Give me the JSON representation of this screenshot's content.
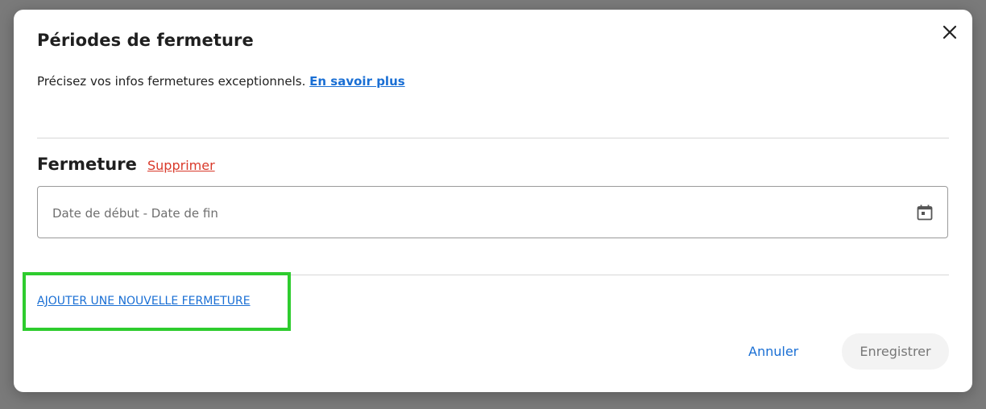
{
  "dialog": {
    "title": "Périodes de fermeture",
    "subtitle_text": "Précisez vos infos fermetures exceptionnels. ",
    "learn_more_link": "En savoir plus",
    "close_icon": "close-icon"
  },
  "closure": {
    "section_title": "Fermeture",
    "delete_link": "Supprimer",
    "date_placeholder": "Date de début - Date de fin",
    "calendar_icon": "calendar-icon"
  },
  "actions": {
    "add_closure_link": "AJOUTER UNE NOUVELLE FERMETURE",
    "cancel_label": "Annuler",
    "save_label": "Enregistrer"
  },
  "colors": {
    "accent_blue": "#1a6fd4",
    "delete_red": "#d93a2b",
    "highlight_green": "#2ecc2e",
    "overlay": "#7a7a7a"
  }
}
